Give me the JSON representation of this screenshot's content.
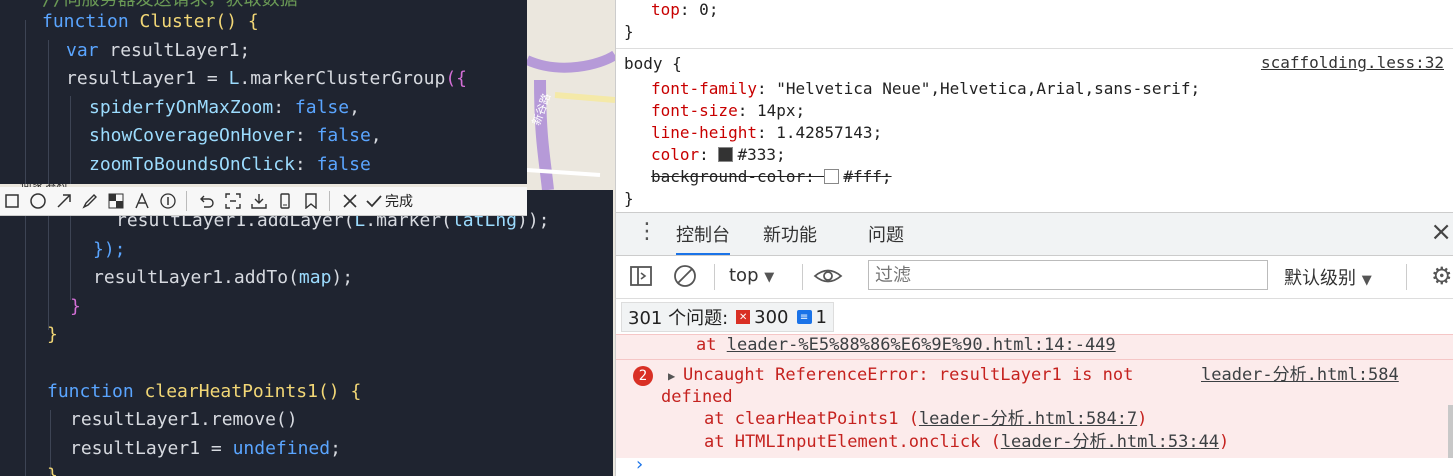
{
  "editor_top": {
    "lines": [
      {
        "comment": "//向服务器发送请求，获取数据"
      },
      {
        "kw": "function",
        "name": "Cluster",
        "rest": "() {"
      },
      {
        "kw": "var",
        "rest": "resultLayer1;"
      },
      {
        "var": "resultLayer1",
        "op": " = ",
        "obj": "L",
        "call": ".markerClusterGroup",
        "paren": "({"
      },
      {
        "prop": "spiderfyOnMaxZoom",
        "val": "false",
        "tail": ","
      },
      {
        "prop": "showCoverageOnHover",
        "val": "false",
        "tail": ","
      },
      {
        "prop": "zoomToBoundsOnClick",
        "val": "false",
        "tail": ""
      }
    ]
  },
  "editor_bottom": {
    "lines": [
      {
        "text_a": "resultLayer1",
        "text_b": ".addLayer(",
        "text_c": "L",
        "text_d": ".marker(",
        "text_e": "latLng",
        "text_f": "));"
      },
      {
        "text": "});"
      },
      {
        "text_a": "resultLayer1",
        "text_b": ".addTo(",
        "text_c": "map",
        "text_d": ");"
      },
      {
        "text": "}"
      },
      {
        "text": "}"
      },
      {
        "text": ""
      },
      {
        "kw": "function",
        "name": "clearHeatPoints1",
        "rest": "() {"
      },
      {
        "text_a": "resultLayer1",
        "text_b": ".remove()"
      },
      {
        "text_a": "resultLayer1",
        "text_b": " = ",
        "text_c": "undefined",
        "text_d": ";"
      },
      {
        "text": "}"
      }
    ]
  },
  "map": {
    "label_left": "何家港村",
    "label_road": "新谷路"
  },
  "snip_toolbar": {
    "done_label": "完成",
    "icons": [
      "rectangle-icon",
      "circle-icon",
      "arrow-icon",
      "pen-icon",
      "mosaic-icon",
      "text-icon",
      "number-icon",
      "undo-icon",
      "ocr-icon",
      "download-icon",
      "phone-icon",
      "bookmark-icon",
      "close-icon",
      "check-icon"
    ]
  },
  "styles_pane": {
    "prev_rule_prop": "top",
    "prev_rule_val": "0",
    "prev_rule_close": "}",
    "selector": "body {",
    "source": "scaffolding.less:32",
    "decls": [
      {
        "prop": "font-family",
        "val": "\"Helvetica Neue\",Helvetica,Arial,sans-serif"
      },
      {
        "prop": "font-size",
        "val": "14px"
      },
      {
        "prop": "line-height",
        "val": "1.42857143"
      },
      {
        "prop": "color",
        "val": "#333",
        "swatch": "#333333"
      },
      {
        "prop": "background-color",
        "val": "#fff",
        "swatch": "#ffffff",
        "struck": true
      }
    ],
    "close": "}"
  },
  "drawer": {
    "tabs": [
      "控制台",
      "新功能",
      "问题"
    ],
    "close": "×"
  },
  "console_toolbar": {
    "context": "top",
    "filter_placeholder": "过滤",
    "level": "默认级别"
  },
  "issues": {
    "label": "301 个问题:",
    "errors": "300",
    "info": "1"
  },
  "console": {
    "line0_prefix": "at ",
    "line0_link": "leader-%E5%88%86%E6%9E%90.html:14:-449",
    "error_count": "2",
    "error_text1": "Uncaught ReferenceError: resultLayer1 is not",
    "error_text2": "defined",
    "error_source": "leader-分析.html:584",
    "stack": [
      {
        "prefix": "at clearHeatPoints1 (",
        "link": "leader-分析.html:584:7",
        "suffix": ")"
      },
      {
        "prefix": "at HTMLInputElement.onclick (",
        "link": "leader-分析.html:53:44",
        "suffix": ")"
      }
    ],
    "prompt": "›"
  },
  "colors": {
    "editor_bg": "#1f2430",
    "keyword": "#5aa5ff",
    "function_name": "#f2d776",
    "error_red": "#d93025",
    "error_bg": "#fcebeb",
    "accent_blue": "#1a73e8"
  }
}
